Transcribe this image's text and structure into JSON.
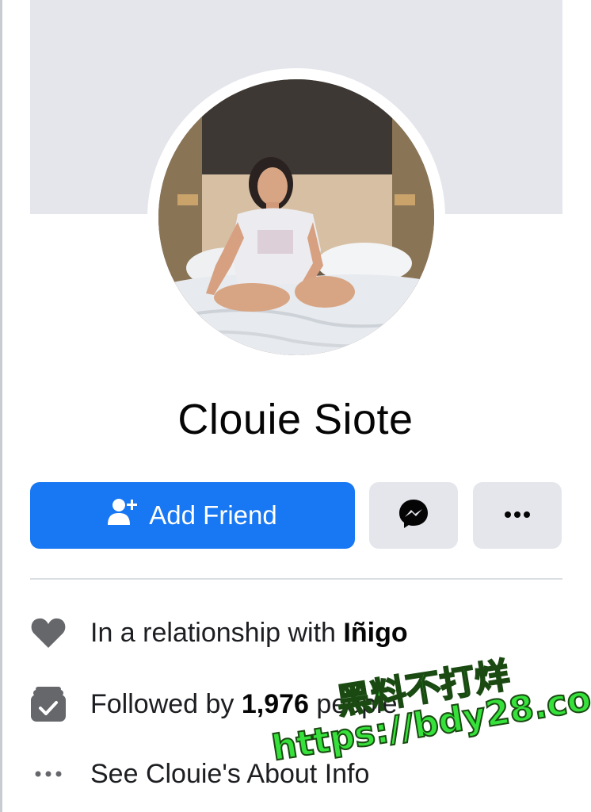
{
  "profile": {
    "name": "Clouie Siote"
  },
  "actions": {
    "add_friend_label": "Add Friend",
    "add_friend_icon": "add-person-icon",
    "message_icon": "messenger-icon",
    "more_icon": "more-dots-icon"
  },
  "info": {
    "relationship": {
      "icon": "heart-icon",
      "prefix": "In a relationship with ",
      "partner": "Iñigo"
    },
    "followers": {
      "icon": "followers-icon",
      "prefix": "Followed by ",
      "count": "1,976",
      "suffix": " people"
    },
    "about": {
      "icon": "more-dots-icon",
      "text": "See Clouie's About Info"
    }
  },
  "watermark": {
    "line1": "黑料不打烊",
    "line2": "https://bdy28.co"
  },
  "colors": {
    "primary": "#1877f2",
    "secondary_button": "#e4e6eb",
    "cover": "#e4e6eb",
    "watermark": "#35e13a"
  }
}
